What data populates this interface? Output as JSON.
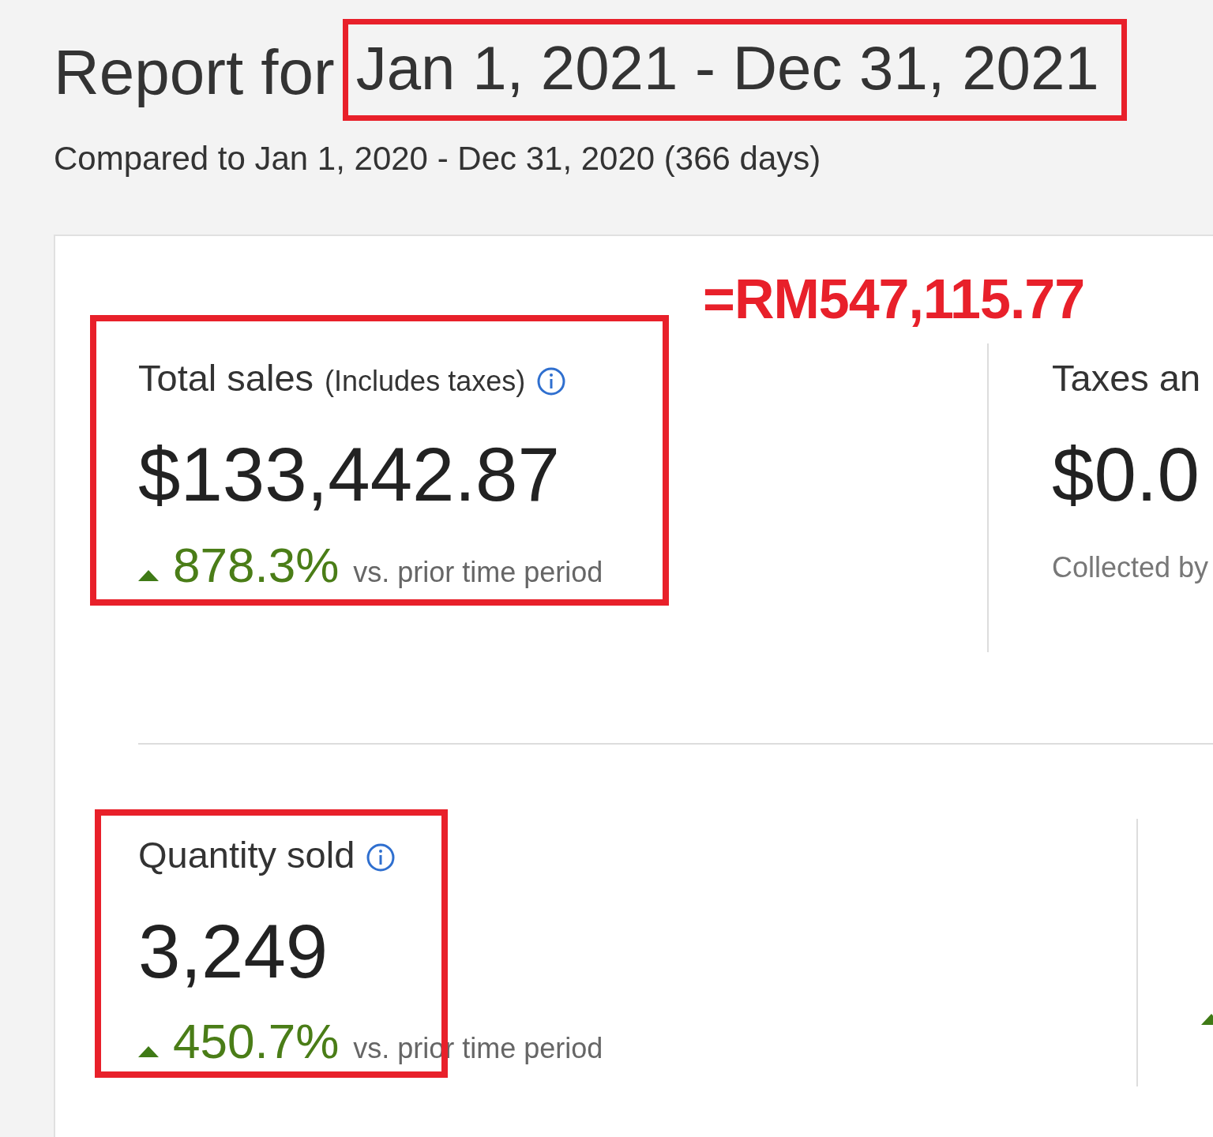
{
  "report": {
    "prefix": "Report for",
    "range": {
      "text": "Jan 1, 2021 - Dec 31, 2021",
      "highlighted": true
    },
    "comparison": "Compared to Jan 1, 2020 - Dec 31, 2020 (366 days)"
  },
  "annotation": "=RM547,115.77",
  "rows": [
    {
      "metrics": [
        {
          "label": "Total sales",
          "note": "(Includes taxes)",
          "info": true,
          "value": "$133,442.87",
          "change": {
            "rising": true,
            "text": "878.3%"
          },
          "suffix": "vs. prior time period",
          "highlighted": true
        },
        {
          "label": "Taxes an",
          "value": "$0.0",
          "caption": "Collected by",
          "highlighted": false
        }
      ]
    },
    {
      "metrics": [
        {
          "label": "Quantity sold",
          "info": true,
          "value": "3,249",
          "change": {
            "rising": true,
            "text": "450.7%"
          },
          "suffix": "vs. prior time period",
          "highlighted": true
        },
        {
          "change": {
            "rising": true
          },
          "highlighted": false
        }
      ]
    }
  ]
}
